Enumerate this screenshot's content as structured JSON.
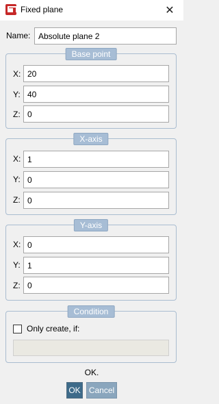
{
  "window": {
    "title": "Fixed plane",
    "close_glyph": "✕",
    "icon": "app-icon"
  },
  "name": {
    "label": "Name:",
    "value": "Absolute plane 2"
  },
  "base_point": {
    "title": "Base point",
    "x_label": "X:",
    "x_value": "20",
    "y_label": "Y:",
    "y_value": "40",
    "z_label": "Z:",
    "z_value": "0"
  },
  "x_axis": {
    "title": "X-axis",
    "x_label": "X:",
    "x_value": "1",
    "y_label": "Y:",
    "y_value": "0",
    "z_label": "Z:",
    "z_value": "0"
  },
  "y_axis": {
    "title": "Y-axis",
    "x_label": "X:",
    "x_value": "0",
    "y_label": "Y:",
    "y_value": "1",
    "z_label": "Z:",
    "z_value": "0"
  },
  "condition": {
    "title": "Condition",
    "checkbox_label": "Only create, if:",
    "checked": false,
    "value": ""
  },
  "status_text": "OK.",
  "buttons": {
    "ok": "OK",
    "cancel": "Cancel"
  }
}
